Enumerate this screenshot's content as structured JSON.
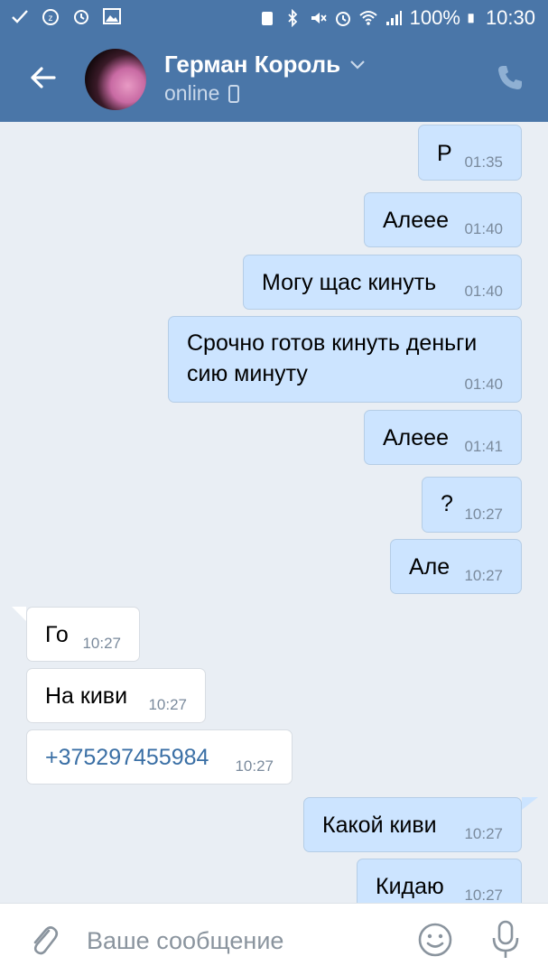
{
  "statusbar": {
    "left_icons": [
      "check-icon",
      "zero-icon",
      "alarm-icon",
      "image-icon"
    ],
    "battery_percent": "100%",
    "time": "10:30"
  },
  "header": {
    "name": "Герман Король",
    "status": "online"
  },
  "messages": [
    {
      "dir": "out",
      "text": "Р",
      "time": "01:35"
    },
    {
      "dir": "out",
      "text": "Алеее",
      "time": "01:40"
    },
    {
      "dir": "out",
      "text": "Могу щас кинуть",
      "time": "01:40"
    },
    {
      "dir": "out",
      "text": "Срочно готов кинуть деньги\nсию минуту",
      "time": "01:40"
    },
    {
      "dir": "out",
      "text": "Алеее",
      "time": "01:41"
    },
    {
      "dir": "out",
      "text": "?",
      "time": "10:27"
    },
    {
      "dir": "out",
      "text": "Але",
      "time": "10:27"
    },
    {
      "dir": "in",
      "text": "Го",
      "time": "10:27"
    },
    {
      "dir": "in",
      "text": "На киви",
      "time": "10:27"
    },
    {
      "dir": "in",
      "text": "+375297455984",
      "time": "10:27",
      "link": true
    },
    {
      "dir": "out",
      "text": "Какой киви",
      "time": "10:27"
    },
    {
      "dir": "out",
      "text": "Кидаю",
      "time": "10:27"
    }
  ],
  "composer": {
    "placeholder": "Ваше сообщение"
  },
  "colors": {
    "header_bg": "#4a76a8",
    "outgoing_bubble": "#cce4ff",
    "incoming_bubble": "#ffffff",
    "chat_bg": "#e9eef4",
    "link": "#3a6fa5"
  }
}
